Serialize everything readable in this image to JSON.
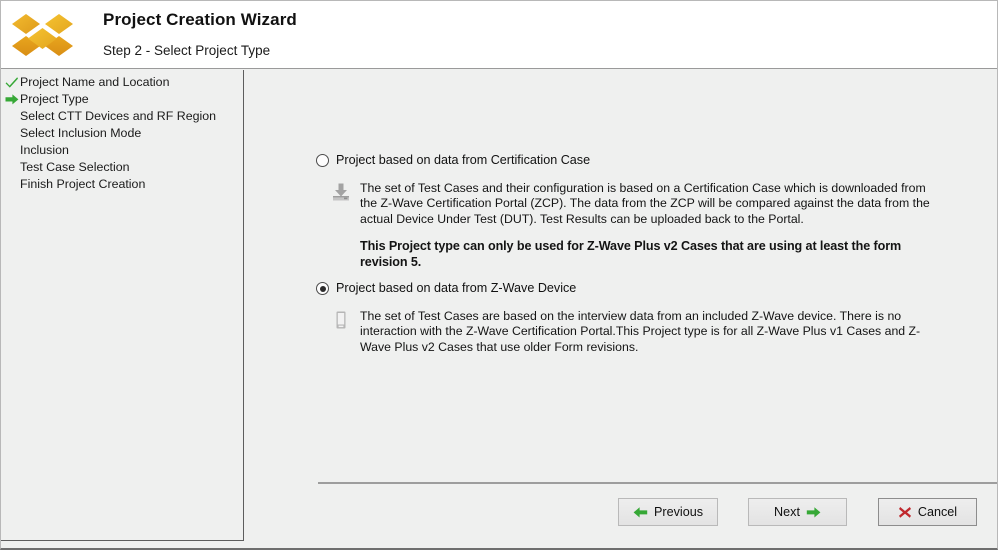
{
  "window": {
    "accent_green": "#36a836",
    "accent_red": "#c0282d",
    "logo_color_light": "#f0b429",
    "logo_color_dark": "#d99316"
  },
  "header": {
    "logo_name": "dropbox-style-diamond-logo",
    "title": "Project Creation Wizard",
    "subtitle": "Step 2 - Select Project Type"
  },
  "sidebar": {
    "steps": [
      {
        "label": "Project Name and Location",
        "state": "completed",
        "icon": "check-icon"
      },
      {
        "label": "Project Type",
        "state": "current",
        "icon": "arrow-right-icon"
      },
      {
        "label": "Select CTT Devices and RF Region",
        "state": "pending",
        "icon": "none"
      },
      {
        "label": "Select Inclusion Mode",
        "state": "pending",
        "icon": "none"
      },
      {
        "label": "Inclusion",
        "state": "pending",
        "icon": "none"
      },
      {
        "label": "Test Case Selection",
        "state": "pending",
        "icon": "none"
      },
      {
        "label": "Finish Project Creation",
        "state": "pending",
        "icon": "none"
      }
    ]
  },
  "main": {
    "options": [
      {
        "id": "certification-case",
        "title": "Project based on data from Certification Case",
        "selected": false,
        "icon": "download-icon",
        "description": "The set of Test Cases and their configuration is based on a Certification Case which is downloaded from the Z-Wave Certification Portal (ZCP). The data from the ZCP will be compared against the data from the actual Device Under Test (DUT). Test Results can be uploaded back to the Portal.",
        "note": "This Project type can only be used for Z-Wave Plus v2 Cases that are using at least the form revision 5."
      },
      {
        "id": "z-wave-device",
        "title": "Project based on data from Z-Wave Device",
        "selected": true,
        "icon": "device-icon",
        "description": "The set of Test Cases are based on the interview data from an included Z-Wave device. There is no interaction with the Z-Wave Certification Portal.This Project type is for all Z-Wave Plus v1 Cases and Z-Wave Plus v2 Cases that use older Form revisions.",
        "note": ""
      }
    ]
  },
  "footer": {
    "previous_label": "Previous",
    "next_label": "Next",
    "cancel_label": "Cancel"
  }
}
